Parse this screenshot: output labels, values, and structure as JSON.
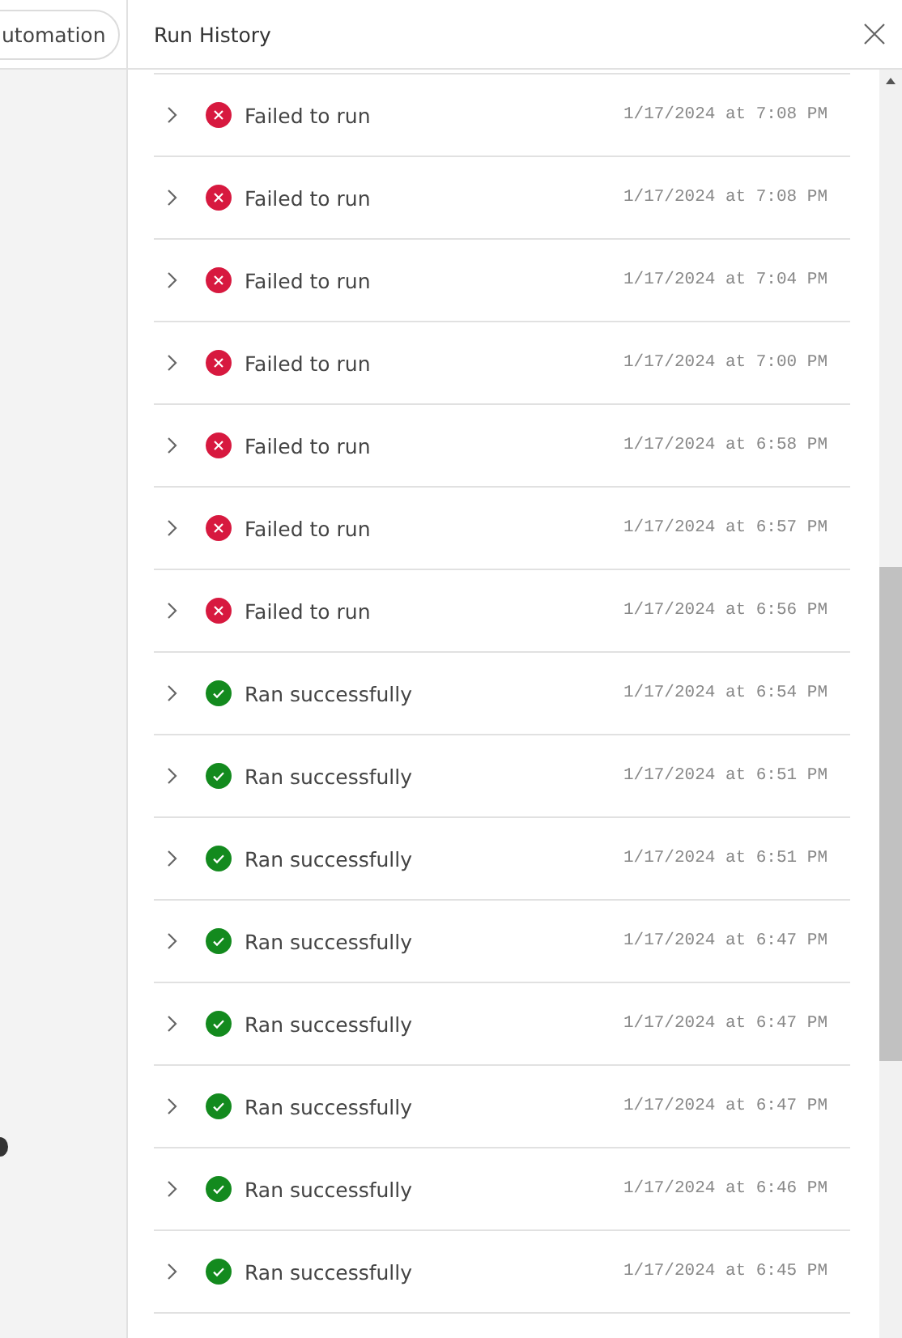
{
  "sidebar": {
    "button": "utomation"
  },
  "panel": {
    "title": "Run History",
    "runs": [
      {
        "kind": "failed",
        "label": "Failed to run",
        "time": "1/17/2024 at 7:08 PM"
      },
      {
        "kind": "failed",
        "label": "Failed to run",
        "time": "1/17/2024 at 7:08 PM"
      },
      {
        "kind": "failed",
        "label": "Failed to run",
        "time": "1/17/2024 at 7:04 PM"
      },
      {
        "kind": "failed",
        "label": "Failed to run",
        "time": "1/17/2024 at 7:00 PM"
      },
      {
        "kind": "failed",
        "label": "Failed to run",
        "time": "1/17/2024 at 6:58 PM"
      },
      {
        "kind": "failed",
        "label": "Failed to run",
        "time": "1/17/2024 at 6:57 PM"
      },
      {
        "kind": "failed",
        "label": "Failed to run",
        "time": "1/17/2024 at 6:56 PM"
      },
      {
        "kind": "success",
        "label": "Ran successfully",
        "time": "1/17/2024 at 6:54 PM"
      },
      {
        "kind": "success",
        "label": "Ran successfully",
        "time": "1/17/2024 at 6:51 PM"
      },
      {
        "kind": "success",
        "label": "Ran successfully",
        "time": "1/17/2024 at 6:51 PM"
      },
      {
        "kind": "success",
        "label": "Ran successfully",
        "time": "1/17/2024 at 6:47 PM"
      },
      {
        "kind": "success",
        "label": "Ran successfully",
        "time": "1/17/2024 at 6:47 PM"
      },
      {
        "kind": "success",
        "label": "Ran successfully",
        "time": "1/17/2024 at 6:47 PM"
      },
      {
        "kind": "success",
        "label": "Ran successfully",
        "time": "1/17/2024 at 6:46 PM"
      },
      {
        "kind": "success",
        "label": "Ran successfully",
        "time": "1/17/2024 at 6:45 PM"
      }
    ]
  }
}
